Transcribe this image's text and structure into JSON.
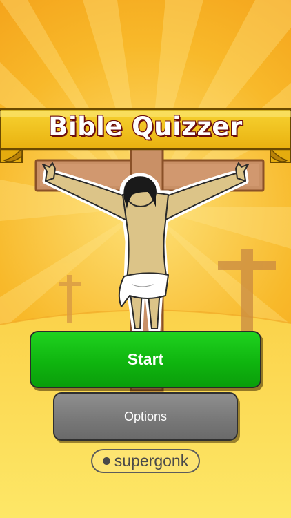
{
  "app": {
    "title": "Bible Quizzer"
  },
  "menu": {
    "start_label": "Start",
    "options_label": "Options"
  },
  "brand": {
    "name": "supergonk"
  },
  "colors": {
    "background_top": "#f39b12",
    "background_bottom": "#fde05a",
    "banner": "#f3c21c",
    "title_outline": "#6b0d0d",
    "start_button": "#14c214",
    "options_button": "#7d7d7d",
    "brand_text": "#4a4a4a"
  },
  "icons": {
    "brand_mark": "dot-icon"
  }
}
